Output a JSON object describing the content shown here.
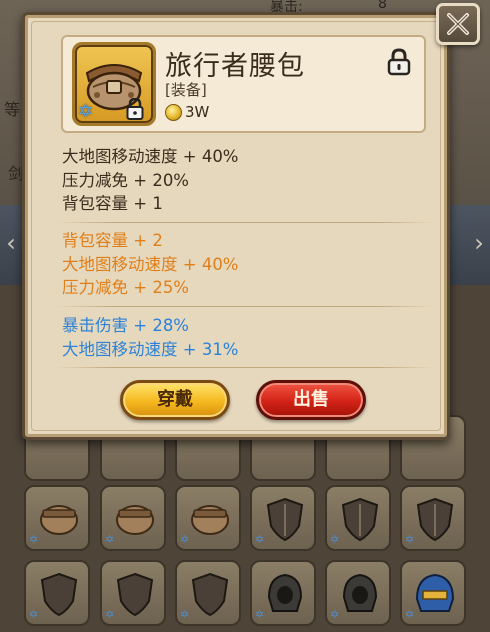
{
  "background": {
    "stat_label": "暴击:",
    "stat_value": "8",
    "side_label_1": "等",
    "side_label_2": "剑"
  },
  "popup": {
    "item": {
      "name": "旅行者腰包",
      "type": "[装备]",
      "price": "3W",
      "icon": "waist-bag-icon",
      "locked": true
    },
    "base_stats": [
      "大地图移动速度 + 40%",
      "压力减免 + 20%",
      "背包容量 + 1"
    ],
    "bonus_stats_orange": [
      "背包容量 + 2",
      "大地图移动速度 + 40%",
      "压力减免 + 25%"
    ],
    "bonus_stats_blue": [
      "暴击伤害 + 28%",
      "大地图移动速度 + 31%"
    ],
    "buttons": {
      "equip": "穿戴",
      "sell": "出售"
    },
    "colors": {
      "base_text": "#3b2c1d",
      "orange_text": "#e07f19",
      "blue_text": "#2c82d8",
      "equip_button": "#f5b81f",
      "sell_button": "#d32217"
    }
  }
}
